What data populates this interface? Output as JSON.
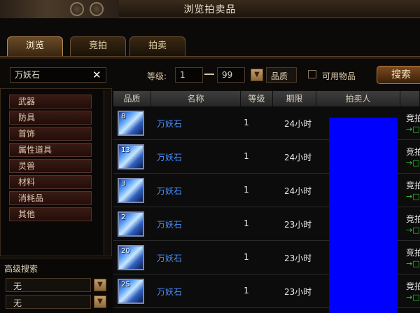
{
  "window": {
    "title": "浏览拍卖品"
  },
  "tabs": [
    {
      "label": "浏览",
      "active": true
    },
    {
      "label": "竞拍",
      "active": false
    },
    {
      "label": "拍卖",
      "active": false
    }
  ],
  "search": {
    "query": "万妖石",
    "level_label": "等级:",
    "level_min": "1",
    "level_max": "99",
    "quality_label": "品质",
    "usable_label": "可用物品",
    "search_button": "搜索"
  },
  "categories": [
    "武器",
    "防具",
    "首饰",
    "属性道具",
    "灵兽",
    "材料",
    "消耗品",
    "其他"
  ],
  "advanced": {
    "title": "高级搜索",
    "filters": [
      "无",
      "无"
    ]
  },
  "table": {
    "columns": [
      "品质",
      "名称",
      "等级",
      "期限",
      "拍卖人"
    ],
    "rows": [
      {
        "qty": "8",
        "name": "万妖石",
        "level": "1",
        "duration": "24小时",
        "bid": "竞拍",
        "arrow": "→□"
      },
      {
        "qty": "13",
        "name": "万妖石",
        "level": "1",
        "duration": "24小时",
        "bid": "竞拍",
        "arrow": "→□"
      },
      {
        "qty": "3",
        "name": "万妖石",
        "level": "1",
        "duration": "24小时",
        "bid": "竞拍",
        "arrow": "→□"
      },
      {
        "qty": "2",
        "name": "万妖石",
        "level": "1",
        "duration": "23小时",
        "bid": "竞拍",
        "arrow": "→□"
      },
      {
        "qty": "20",
        "name": "万妖石",
        "level": "1",
        "duration": "23小时",
        "bid": "竞拍",
        "arrow": "→□"
      },
      {
        "qty": "25",
        "name": "万妖石",
        "level": "1",
        "duration": "23小时",
        "bid": "竞拍",
        "arrow": "→□"
      }
    ]
  },
  "colors": {
    "item_name": "#4a90ff",
    "seller_redaction": "#0000ff",
    "bid_arrow": "#2ad02a"
  }
}
